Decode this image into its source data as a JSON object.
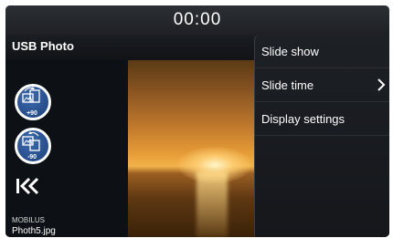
{
  "status_bar": {
    "clock": "00:00"
  },
  "header": {
    "title": "USB Photo"
  },
  "controls": {
    "rotate_right": {
      "label": "+90",
      "icon": "rotate-clockwise-icon"
    },
    "rotate_left": {
      "label": "-90",
      "icon": "rotate-counterclockwise-icon"
    },
    "back": {
      "icon": "double-chevron-left-icon"
    }
  },
  "footer": {
    "brand": "MOBILUS",
    "filename": "Photh5.jpg"
  },
  "menu": {
    "items": [
      {
        "label": "Slide show",
        "has_submenu": false
      },
      {
        "label": "Slide time",
        "has_submenu": true
      },
      {
        "label": "Display settings",
        "has_submenu": false
      }
    ]
  },
  "colors": {
    "background": "#0b0d10",
    "accent_blue": "#2e5ca6",
    "text": "#ffffff"
  }
}
